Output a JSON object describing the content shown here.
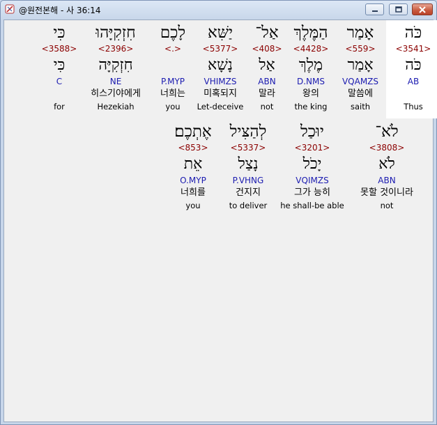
{
  "window": {
    "title": "@원전본해 - 사 36:14"
  },
  "verse": {
    "row1": [
      {
        "hebrew": "כֹּה",
        "strong": "<3541>",
        "lemma": "כֹּה",
        "morph": "AB",
        "korean": "",
        "english": "Thus",
        "highlight": true
      },
      {
        "hebrew": "אָמַר",
        "strong": "<559>",
        "lemma": "אָמַר",
        "morph": "VQAMZS",
        "korean": "말씀에",
        "english": "saith",
        "highlight": false
      },
      {
        "hebrew": "הַמֶּלֶךְ",
        "strong": "<4428>",
        "lemma": "מֶלֶךְ",
        "morph": "D.NMS",
        "korean": "왕의",
        "english": "the king",
        "highlight": false
      },
      {
        "hebrew": "אַל־",
        "strong": "<408>",
        "lemma": "אַל",
        "morph": "ABN",
        "korean": "말라",
        "english": "not",
        "highlight": false
      },
      {
        "hebrew": "יַשִּׁא",
        "strong": "<5377>",
        "lemma": "נָשָׁא",
        "morph": "VHIMZS",
        "korean": "미혹되지",
        "english": "Let-deceive",
        "highlight": false
      },
      {
        "hebrew": "לָכֶם",
        "strong": "<.>",
        "lemma": "",
        "morph": "P.MYP",
        "korean": "너희는",
        "english": "you",
        "highlight": false
      },
      {
        "hebrew": "חִזְקִיָּהוּ",
        "strong": "<2396>",
        "lemma": "חִזְקִיָּה",
        "morph": "NE",
        "korean": "히스기야에게",
        "english": "Hezekiah",
        "highlight": false
      },
      {
        "hebrew": "כִּי",
        "strong": "<3588>",
        "lemma": "כִּי",
        "morph": "C",
        "korean": "",
        "english": "for",
        "highlight": false
      }
    ],
    "row2": [
      {
        "hebrew": "לֹא־",
        "strong": "<3808>",
        "lemma": "לֹא",
        "morph": "ABN",
        "korean": "못할 것이니라",
        "english": "not",
        "highlight": false
      },
      {
        "hebrew": "יוּכַל",
        "strong": "<3201>",
        "lemma": "יָכֹל",
        "morph": "VQIMZS",
        "korean": "그가 능히",
        "english": "he shall-be able",
        "highlight": false
      },
      {
        "hebrew": "לְהַצִּיל",
        "strong": "<5337>",
        "lemma": "נָצַל",
        "morph": "P.VHNG",
        "korean": "건지지",
        "english": "to deliver",
        "highlight": false
      },
      {
        "hebrew": "אֶתְכֶם׃",
        "strong": "<853>",
        "lemma": "אֵת",
        "morph": "O.MYP",
        "korean": "너희를",
        "english": "you",
        "highlight": false
      }
    ]
  }
}
